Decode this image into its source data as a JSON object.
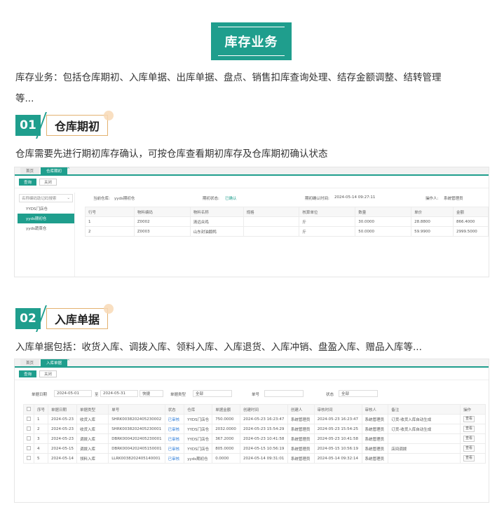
{
  "title": "库存业务",
  "intro": {
    "line1": "库存业务：包括仓库期初、入库单据、出库单据、盘点、销售扣库查询处理、结存金额调整、结转管理",
    "line2": "等..."
  },
  "section1": {
    "num": "01",
    "label": "仓库期初",
    "desc": "仓库需要先进行期初库存确认，可按仓库查看期初库存及仓库期初确认状态",
    "screenshot": {
      "tabs": [
        "首页",
        "仓库期初"
      ],
      "toolbar": {
        "query": "查询",
        "close": "关闭"
      },
      "sidebar": {
        "search_placeholder": "名称编码助记码搜索",
        "items": [
          "YYDS门店仓",
          "yyds期初仓",
          "yyds蔬菜仓"
        ]
      },
      "info": {
        "warehouse_label": "当前仓库:",
        "warehouse_value": "yyds期初仓",
        "status_label": "期初状态:",
        "status_value": "已确认",
        "time_label": "期初确认时间:",
        "time_value": "2024-05-14 09:27:11",
        "operator_label": "操作人:",
        "operator_value": "系统管理员"
      },
      "table": {
        "headers": [
          "行号",
          "物料编码",
          "物料名称",
          "规格",
          "核算单位",
          "数量",
          "单价",
          "金额"
        ],
        "rows": [
          [
            "1",
            "Z0002",
            "清远众鸡",
            "",
            "斤",
            "30.0000",
            "28.8800",
            "866.4000"
          ],
          [
            "2",
            "Z0003",
            "山东封油鹅鸭",
            "",
            "斤",
            "50.0000",
            "59.9900",
            "2999.5000"
          ]
        ]
      }
    }
  },
  "section2": {
    "num": "02",
    "label": "入库单据",
    "desc": "入库单据包括：收货入库、调拨入库、领料入库、入库退货、入库冲销、盘盈入库、赠品入库等...",
    "screenshot": {
      "tabs": [
        "首页",
        "入库单据"
      ],
      "toolbar": {
        "query": "查询",
        "close": "关闭"
      },
      "filters": {
        "date_label": "单据日期",
        "date_from": "2024-05-01",
        "to": "至",
        "date_to": "2024-05-31",
        "shortcut": "快捷",
        "type_label": "单据类型",
        "type_value": "全部",
        "no_label": "单号",
        "status_label": "状态",
        "status_value": "全部"
      },
      "table": {
        "headers": [
          "",
          "序号",
          "单据日期",
          "单据类型",
          "单号",
          "状态",
          "仓库",
          "单据金额",
          "创建时间",
          "创建人",
          "审核时间",
          "审核人",
          "备注",
          "操作"
        ],
        "rows": [
          [
            "",
            "1",
            "2024-05-23",
            "收货入库",
            "SHRK0038202405230002",
            "已审核",
            "YYDS门店仓",
            "750.0000",
            "2024-05-23 16:23:47",
            "系统管理员",
            "2024-05-23 16:23:47",
            "系统管理员",
            "订货-收货入库自动生成",
            "查看"
          ],
          [
            "",
            "2",
            "2024-05-23",
            "收货入库",
            "SHRK0038202405230001",
            "已审核",
            "YYDS门店仓",
            "2032.0000",
            "2024-05-23 15:54:29",
            "系统管理员",
            "2024-05-23 15:54:25",
            "系统管理员",
            "订货-收货入库自动生成",
            "查看"
          ],
          [
            "",
            "3",
            "2024-05-23",
            "调拨入库",
            "DBRK0004202405230001",
            "已审核",
            "YYDS门店仓",
            "367.2000",
            "2024-05-23 10:41:58",
            "系统管理员",
            "2024-05-23 10:41:58",
            "系统管理员",
            "",
            "查看"
          ],
          [
            "",
            "4",
            "2024-05-15",
            "调拨入库",
            "DBRK0004202405150001",
            "已审核",
            "YYDS门店仓",
            "805.0000",
            "2024-05-15 10:56:19",
            "系统管理员",
            "2024-05-15 10:56:19",
            "系统管理员",
            "店间调拨",
            "查看"
          ],
          [
            "",
            "5",
            "2024-05-14",
            "领料入库",
            "LLRK0038202405140001",
            "已审核",
            "yyds期初仓",
            "0.0000",
            "2024-05-14 09:31:01",
            "系统管理员",
            "2024-05-14 09:32:14",
            "系统管理员",
            "",
            "查看"
          ]
        ]
      }
    }
  },
  "colors": {
    "accent": "#1f9e8d",
    "border_gold": "#e3b270",
    "link_blue": "#2b7bd8"
  }
}
